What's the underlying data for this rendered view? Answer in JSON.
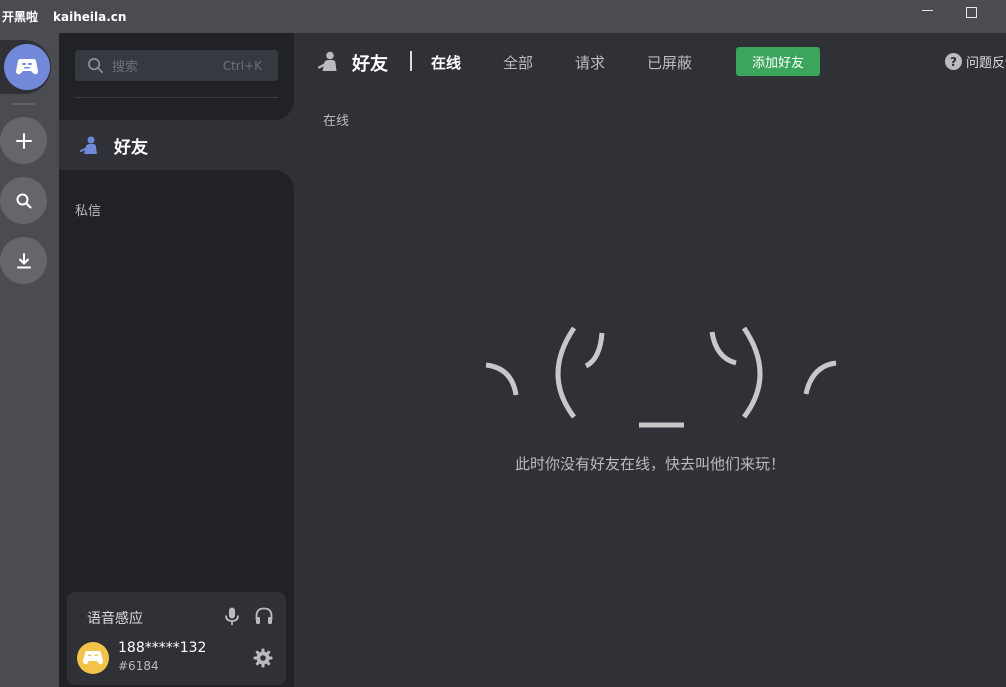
{
  "titlebar": {
    "brand": "开黑啦",
    "domain": "kaiheila.cn"
  },
  "rail": {
    "items": [
      {
        "name": "home",
        "icon": "kaiheila-logo-icon"
      },
      {
        "name": "add-server",
        "icon": "plus-icon"
      },
      {
        "name": "discover",
        "icon": "search-icon"
      },
      {
        "name": "download",
        "icon": "download-icon"
      }
    ]
  },
  "sidebar": {
    "search": {
      "placeholder": "搜索",
      "shortcut": "Ctrl+K"
    },
    "friends_label": "好友",
    "dm_label": "私信"
  },
  "user_panel": {
    "voice_mode": "语音感应",
    "username": "188*****132",
    "tag": "#6184"
  },
  "main": {
    "title": "好友",
    "tabs": [
      {
        "label": "在线",
        "active": true
      },
      {
        "label": "全部",
        "active": false
      },
      {
        "label": "请求",
        "active": false
      },
      {
        "label": "已屏蔽",
        "active": false
      }
    ],
    "add_friend_label": "添加好友",
    "help_label": "问题反馈",
    "section_label": "在线",
    "empty_message": "此时你没有好友在线，快去叫他们来玩！"
  },
  "colors": {
    "accent": "#7289da",
    "success": "#3ba55c",
    "avatar": "#f3c248"
  }
}
